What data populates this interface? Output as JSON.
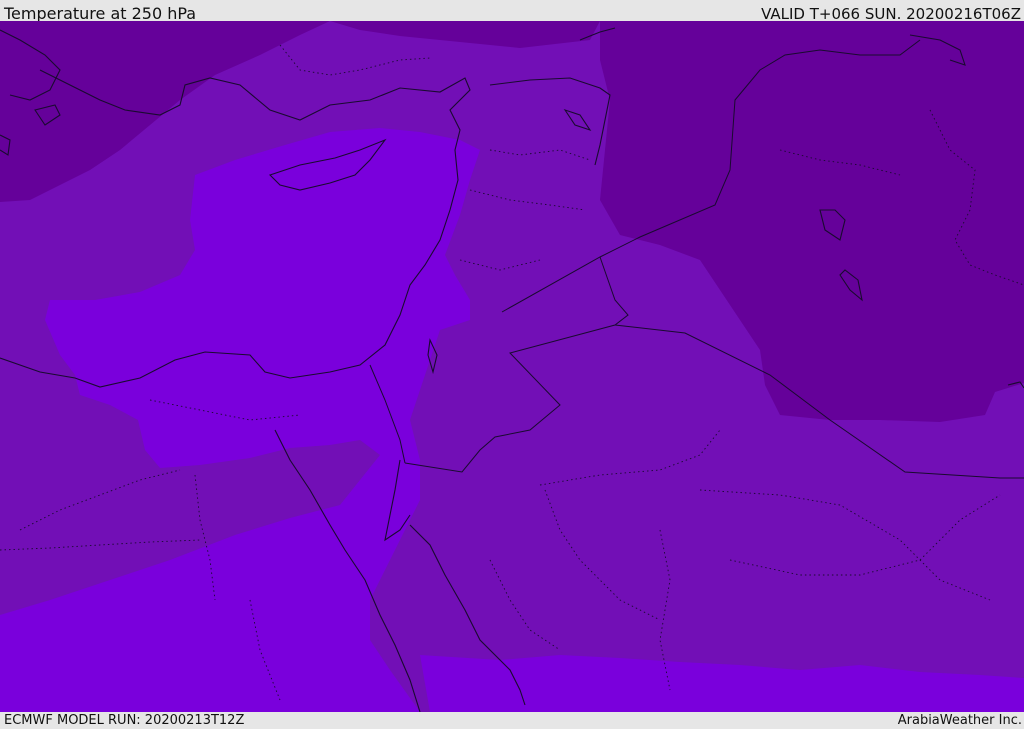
{
  "header": {
    "title": "Temperature at 250 hPa",
    "valid_time": "VALID T+066 SUN. 20200216T06Z"
  },
  "footer": {
    "model_run": "ECMWF MODEL RUN: 20200213T12Z",
    "credit": "ArabiaWeather Inc."
  },
  "colors": {
    "band_warmest": "#7a00dc",
    "band_mid": "#720fb6",
    "band_cold": "#65019a",
    "coastline": "#1a0a30"
  }
}
